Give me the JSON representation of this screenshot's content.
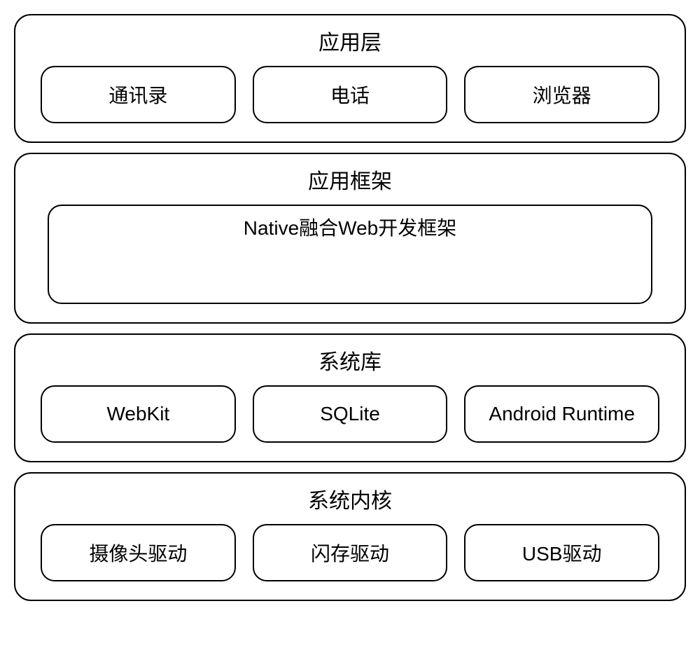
{
  "layers": [
    {
      "title": "应用层",
      "type": "row",
      "items": [
        "通讯录",
        "电话",
        "浏览器"
      ]
    },
    {
      "title": "应用框架",
      "type": "wide",
      "item": "Native融合Web开发框架"
    },
    {
      "title": "系统库",
      "type": "row",
      "items": [
        "WebKit",
        "SQLite",
        "Android Runtime"
      ]
    },
    {
      "title": "系统内核",
      "type": "row",
      "items": [
        "摄像头驱动",
        "闪存驱动",
        "USB驱动"
      ]
    }
  ]
}
